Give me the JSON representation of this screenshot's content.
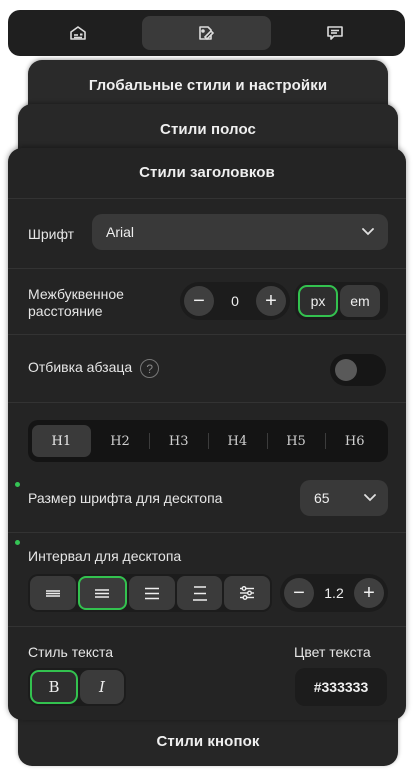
{
  "tabs": [
    {
      "icon": "layout-icon",
      "active": false
    },
    {
      "icon": "paint-icon",
      "active": true
    },
    {
      "icon": "chat-icon",
      "active": false
    }
  ],
  "panels": {
    "global": "Глобальные стили и настройки",
    "strips": "Стили полос",
    "headings": "Стили заголовков",
    "buttons": "Стили кнопок"
  },
  "headings_panel": {
    "font": {
      "label": "Шрифт",
      "value": "Arial"
    },
    "letter_spacing": {
      "label_line1": "Межбуквенное",
      "label_line2": "расстояние",
      "minus": "−",
      "value": "0",
      "plus": "+",
      "units": [
        "px",
        "em"
      ],
      "selected_unit": "px"
    },
    "paragraph": {
      "label": "Отбивка абзаца",
      "help": "?",
      "enabled": false
    },
    "heading_levels": [
      "H1",
      "H2",
      "H3",
      "H4",
      "H5",
      "H6"
    ],
    "active_level": "H1",
    "font_size": {
      "label": "Размер шрифта для десктопа",
      "value": "65"
    },
    "line_height": {
      "label": "Интервал для десктопа",
      "value": "1.2",
      "minus": "−",
      "plus": "+",
      "selected_align": "center"
    },
    "text_style": {
      "label": "Стиль текста",
      "bold": "B",
      "italic": "I",
      "bold_selected": true
    },
    "text_color": {
      "label": "Цвет текста",
      "value": "#333333"
    }
  },
  "colors": {
    "accent": "#33c24f",
    "panel": "#242424"
  }
}
